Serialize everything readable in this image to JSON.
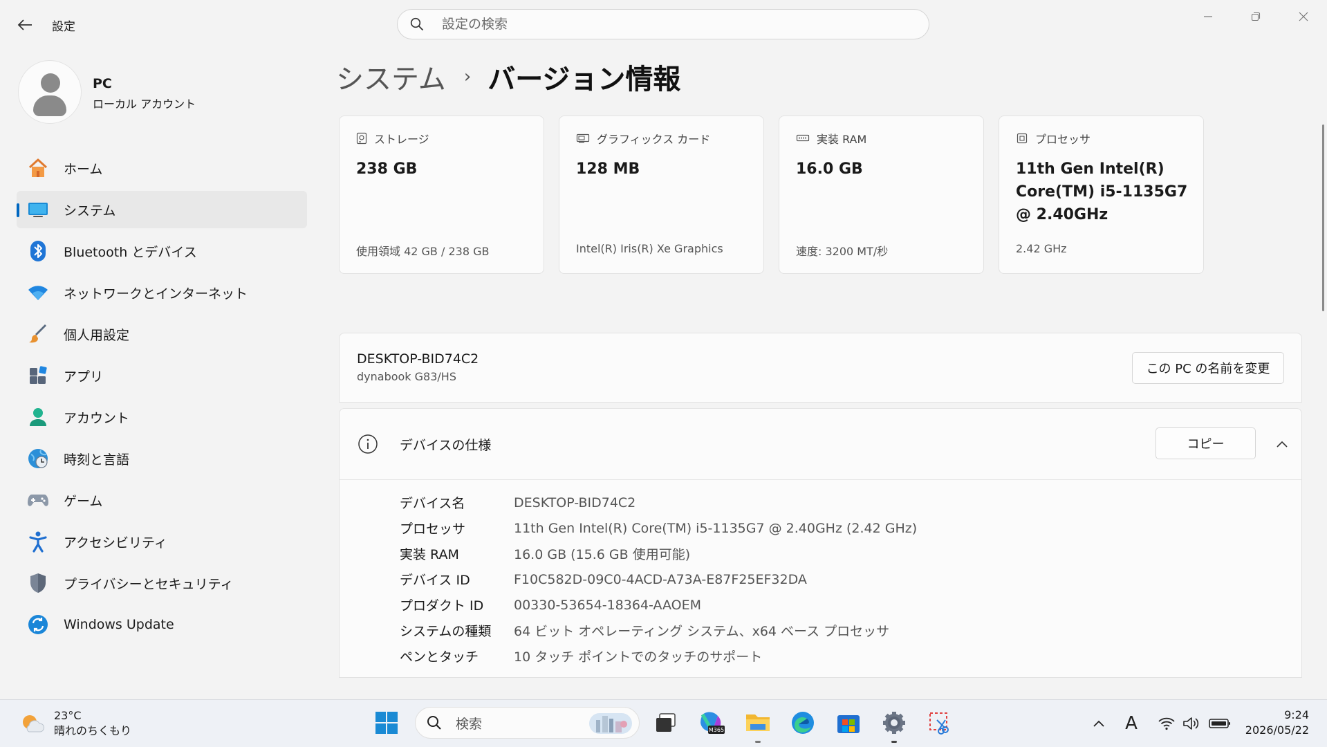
{
  "titlebar": {
    "title": "設定",
    "search_placeholder": "設定の検索"
  },
  "profile": {
    "name": "PC",
    "account_type": "ローカル アカウント"
  },
  "sidebar": {
    "items": [
      {
        "label": "ホーム",
        "icon": "home-icon"
      },
      {
        "label": "システム",
        "icon": "system-icon",
        "active": true
      },
      {
        "label": "Bluetooth とデバイス",
        "icon": "bluetooth-icon"
      },
      {
        "label": "ネットワークとインターネット",
        "icon": "wifi-icon"
      },
      {
        "label": "個人用設定",
        "icon": "brush-icon"
      },
      {
        "label": "アプリ",
        "icon": "apps-icon"
      },
      {
        "label": "アカウント",
        "icon": "account-icon"
      },
      {
        "label": "時刻と言語",
        "icon": "globe-clock-icon"
      },
      {
        "label": "ゲーム",
        "icon": "gamepad-icon"
      },
      {
        "label": "アクセシビリティ",
        "icon": "accessibility-icon"
      },
      {
        "label": "プライバシーとセキュリティ",
        "icon": "shield-icon"
      },
      {
        "label": "Windows Update",
        "icon": "update-icon"
      }
    ]
  },
  "breadcrumb": {
    "parent": "システム",
    "separator": "›",
    "current": "バージョン情報"
  },
  "cards": [
    {
      "title": "ストレージ",
      "value": "238 GB",
      "sub": "使用領域 42 GB / 238 GB",
      "icon": "storage-icon"
    },
    {
      "title": "グラフィックス カード",
      "value": "128 MB",
      "sub": "Intel(R) Iris(R) Xe Graphics",
      "icon": "gpu-icon"
    },
    {
      "title": "実装 RAM",
      "value": "16.0 GB",
      "sub": "速度: 3200 MT/秒",
      "icon": "ram-icon"
    },
    {
      "title": "プロセッサ",
      "value": "11th Gen Intel(R) Core(TM) i5-1135G7 @ 2.40GHz",
      "sub": "2.42 GHz",
      "icon": "processor-icon"
    }
  ],
  "pc": {
    "name": "DESKTOP-BID74C2",
    "model": "dynabook G83/HS",
    "rename_label": "この PC の名前を変更"
  },
  "specs": {
    "title": "デバイスの仕様",
    "copy_label": "コピー",
    "rows": [
      {
        "key": "デバイス名",
        "value": "DESKTOP-BID74C2"
      },
      {
        "key": "プロセッサ",
        "value": "11th Gen Intel(R) Core(TM) i5-1135G7 @ 2.40GHz (2.42 GHz)"
      },
      {
        "key": "実装 RAM",
        "value": "16.0 GB (15.6 GB 使用可能)"
      },
      {
        "key": "デバイス ID",
        "value": "F10C582D-09C0-4ACD-A73A-E87F25EF32DA"
      },
      {
        "key": "プロダクト ID",
        "value": "00330-53654-18364-AAOEM"
      },
      {
        "key": "システムの種類",
        "value": "64 ビット オペレーティング システム、x64 ベース プロセッサ"
      },
      {
        "key": "ペンとタッチ",
        "value": "10 タッチ ポイントでのタッチのサポート"
      }
    ]
  },
  "taskbar": {
    "weather_temp": "23°C",
    "weather_desc": "晴れのちくもり",
    "search_label": "検索",
    "m365_badge": "M365",
    "time": "9:24",
    "date": "2026/05/22",
    "ime": "A"
  },
  "colors": {
    "accent": "#0067c0",
    "background": "#f3f3f3",
    "card": "#fbfbfb"
  }
}
